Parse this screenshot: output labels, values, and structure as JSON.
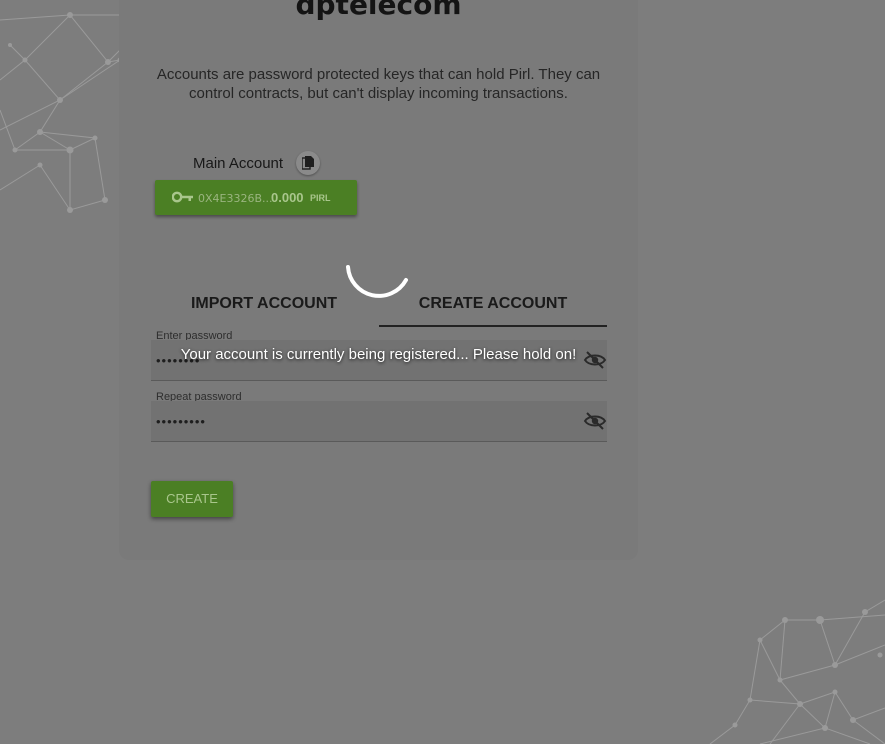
{
  "brand": {
    "title": "dptelecom"
  },
  "intro": {
    "description": "Accounts are password protected keys that can hold Pirl. They can control contracts, but can't display incoming transactions."
  },
  "main_account": {
    "label": "Main Account",
    "address": "0X4E3326B...",
    "balance": "0.000",
    "currency": "PIRL",
    "icons": {
      "copy": "copy-icon",
      "key": "key-icon"
    }
  },
  "tabs": [
    {
      "label": "IMPORT ACCOUNT",
      "active": false
    },
    {
      "label": "CREATE ACCOUNT",
      "active": true
    }
  ],
  "form": {
    "password_label": "Enter password",
    "password_value": "••••••••",
    "repeat_label": "Repeat password",
    "repeat_value": "•••••••••",
    "visibility_icon": "eye-off-icon",
    "submit_label": "CREATE"
  },
  "loading": {
    "message": "Your account is currently being registered... Please hold on!",
    "icon": "spinner-icon"
  },
  "colors": {
    "overlay": "#7d7d7d",
    "accent": "#4b7f24",
    "accent_text": "#a9c68c"
  }
}
